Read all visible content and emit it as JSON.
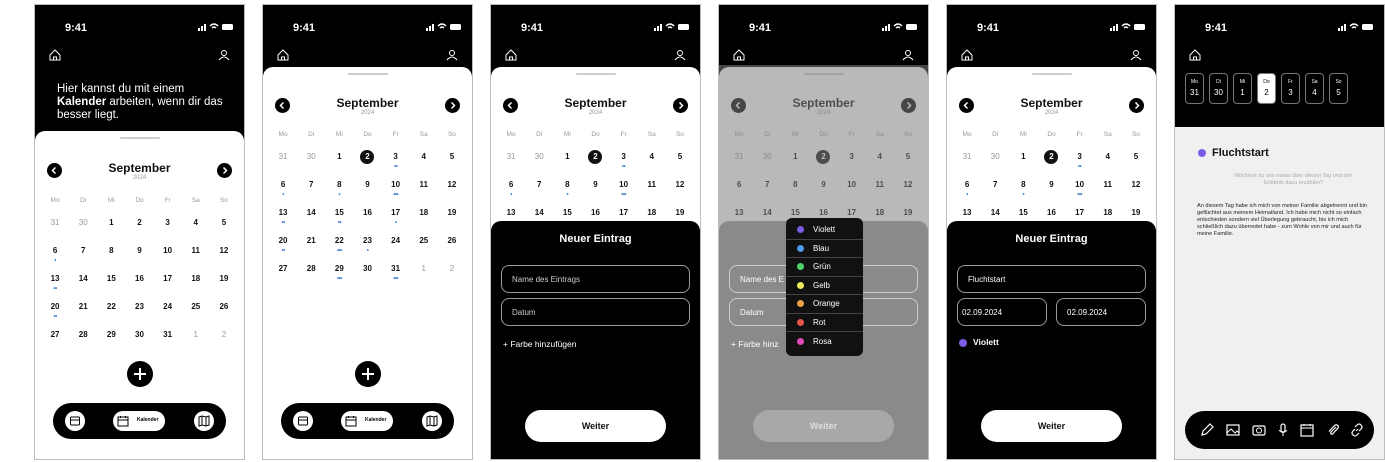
{
  "status": {
    "time": "9:41"
  },
  "intro": {
    "pre": "Hier kannst du mit einem ",
    "bold": "Kalender",
    "post": " arbeiten, wenn dir das besser liegt."
  },
  "calendar": {
    "month": "September",
    "year": "2024",
    "weekdays": [
      "Mo",
      "Di",
      "Mi",
      "Do",
      "Fr",
      "Sa",
      "So"
    ],
    "weeks": [
      [
        "31",
        "30",
        "1",
        "2",
        "3",
        "4",
        "5"
      ],
      [
        "6",
        "7",
        "8",
        "9",
        "10",
        "11",
        "12"
      ],
      [
        "13",
        "14",
        "15",
        "16",
        "17",
        "18",
        "19"
      ],
      [
        "20",
        "21",
        "22",
        "23",
        "24",
        "25",
        "26"
      ],
      [
        "27",
        "28",
        "29",
        "30",
        "31",
        "1",
        "2"
      ]
    ]
  },
  "tabbar": {
    "kalender_label": "Kalender"
  },
  "form": {
    "title": "Neuer Eintrag",
    "name_placeholder": "Name des Eintrags",
    "date_placeholder": "Datum",
    "add_color": "+ Farbe hinzufügen",
    "add_color_cut": "+ Farbe hinz",
    "name_cut": "Name des E",
    "next": "Weiter"
  },
  "colors": [
    {
      "name": "Violett",
      "hex": "#7b5ce6"
    },
    {
      "name": "Blau",
      "hex": "#4a9be8"
    },
    {
      "name": "Grün",
      "hex": "#4fd16a"
    },
    {
      "name": "Gelb",
      "hex": "#e8e85a"
    },
    {
      "name": "Orange",
      "hex": "#f0a04a"
    },
    {
      "name": "Rot",
      "hex": "#e8564a"
    },
    {
      "name": "Rosa",
      "hex": "#e04ab8"
    }
  ],
  "filled": {
    "name": "Fluchtstart",
    "date_from": "02.09.2024",
    "date_to": "02.09.2024",
    "color": "Violett"
  },
  "days": [
    {
      "w": "Mo",
      "d": "31"
    },
    {
      "w": "Di",
      "d": "30"
    },
    {
      "w": "Mi",
      "d": "1"
    },
    {
      "w": "Do",
      "d": "2"
    },
    {
      "w": "Fr",
      "d": "3"
    },
    {
      "w": "Sa",
      "d": "4"
    },
    {
      "w": "So",
      "d": "5"
    }
  ],
  "entry": {
    "title": "Fluchtstart",
    "hint": "Möchtest du uns etwas über diesen Tag und den Erlebnis dazu erzählen?",
    "text": "An diesem Tag habe ich mich von meiner Familie abgetrennt und bin geflüchtet aus meinem Heimatland. Ich habe mich nicht so einfach entschieden sondern viel Überlegung gebraucht, bis ich mich schließlich dazu überredet habe - zum Wohle von mir und auch für meine Familie."
  }
}
